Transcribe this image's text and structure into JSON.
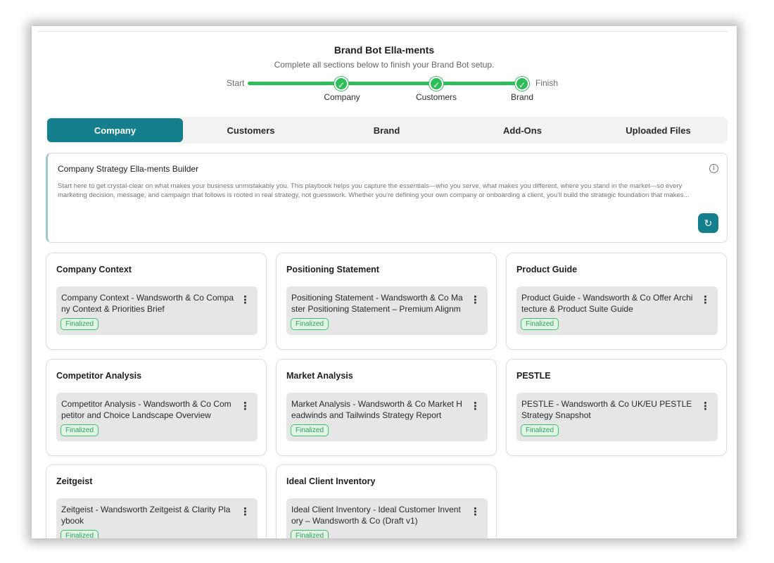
{
  "header": {
    "title": "Brand Bot Ella-ments",
    "subtitle": "Complete all sections below to finish your Brand Bot setup."
  },
  "progress": {
    "start_label": "Start",
    "finish_label": "Finish",
    "steps": [
      {
        "label": "Company",
        "icon": "check-icon"
      },
      {
        "label": "Customers",
        "icon": "check-icon"
      },
      {
        "label": "Brand",
        "icon": "check-icon"
      }
    ]
  },
  "tabs": [
    {
      "label": "Company",
      "active": true
    },
    {
      "label": "Customers",
      "active": false
    },
    {
      "label": "Brand",
      "active": false
    },
    {
      "label": "Add-Ons",
      "active": false
    },
    {
      "label": "Uploaded Files",
      "active": false
    }
  ],
  "intro": {
    "title": "Company Strategy Ella-ments Builder",
    "body": "Start here to get crystal-clear on what makes your business unmistakably you. This playbook helps you capture the essentials—who you serve, what makes you different, where you stand in the market—so every marketing decision, message, and campaign that follows is rooted in real strategy, not guesswork. Whether you're defining your own company or onboarding a client, you'll build the strategic foundation that makes..."
  },
  "cards": [
    {
      "title": "Company Context",
      "doc": "Company Context - Wandsworth & Co Company Context & Priorities Brief",
      "status": "Finalized"
    },
    {
      "title": "Positioning Statement",
      "doc": "Positioning Statement - Wandsworth & Co Master Positioning Statement – Premium Alignment...",
      "status": "Finalized"
    },
    {
      "title": "Product Guide",
      "doc": "Product Guide - Wandsworth & Co Offer Architecture & Product Suite Guide",
      "status": "Finalized"
    },
    {
      "title": "Competitor Analysis",
      "doc": "Competitor Analysis - Wandsworth & Co Competitor and Choice Landscape Overview",
      "status": "Finalized"
    },
    {
      "title": "Market Analysis",
      "doc": "Market Analysis - Wandsworth & Co Market Headwinds and Tailwinds Strategy Report",
      "status": "Finalized"
    },
    {
      "title": "PESTLE",
      "doc": "PESTLE - Wandsworth & Co UK/EU PESTLE Strategy Snapshot",
      "status": "Finalized"
    },
    {
      "title": "Zeitgeist",
      "doc": "Zeitgeist - Wandsworth Zeitgeist & Clarity Playbook",
      "status": "Finalized"
    },
    {
      "title": "Ideal Client Inventory",
      "doc": "Ideal Client Inventory - Ideal Customer Inventory – Wandsworth & Co (Draft v1)",
      "status": "Finalized"
    }
  ],
  "colors": {
    "accent": "#157f8e",
    "progress_green": "#2ebd59",
    "finalized_bg": "#e1f5e6",
    "finalized_border": "#3fbf68"
  }
}
